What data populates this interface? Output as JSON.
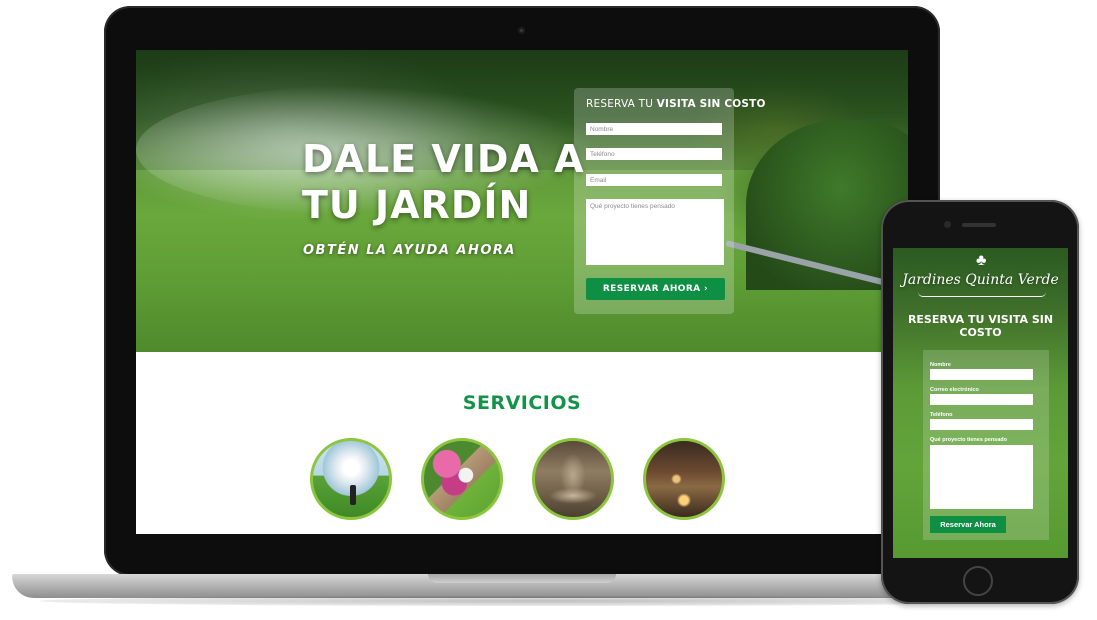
{
  "hero": {
    "title_line1": "DALE VIDA A",
    "title_line2": "TU JARDÍN",
    "subtitle": "OBTÉN LA AYUDA AHORA"
  },
  "form": {
    "title_prefix": "RESERVA TU",
    "title_emphasis": "VISITA SIN COSTO",
    "name_placeholder": "Nombre",
    "phone_placeholder": "Teléfono",
    "email_placeholder": "Email",
    "project_placeholder": "Qué proyecto tienes pensado",
    "submit_label": "RESERVAR AHORA ›"
  },
  "services": {
    "title": "SERVICIOS"
  },
  "mobile": {
    "logo_text": "Jardines Quinta Verde",
    "logo_icon": "clover-icon",
    "title": "RESERVA TU VISITA SIN COSTO",
    "labels": {
      "name": "Nombre",
      "email": "Correo electrónico",
      "phone": "Teléfono",
      "project": "Qué proyecto tienes pensado"
    },
    "submit_label": "Reservar Ahora"
  },
  "colors": {
    "brand_green": "#0e8f43",
    "services_green": "#129447",
    "circle_border": "#8cc63f"
  }
}
